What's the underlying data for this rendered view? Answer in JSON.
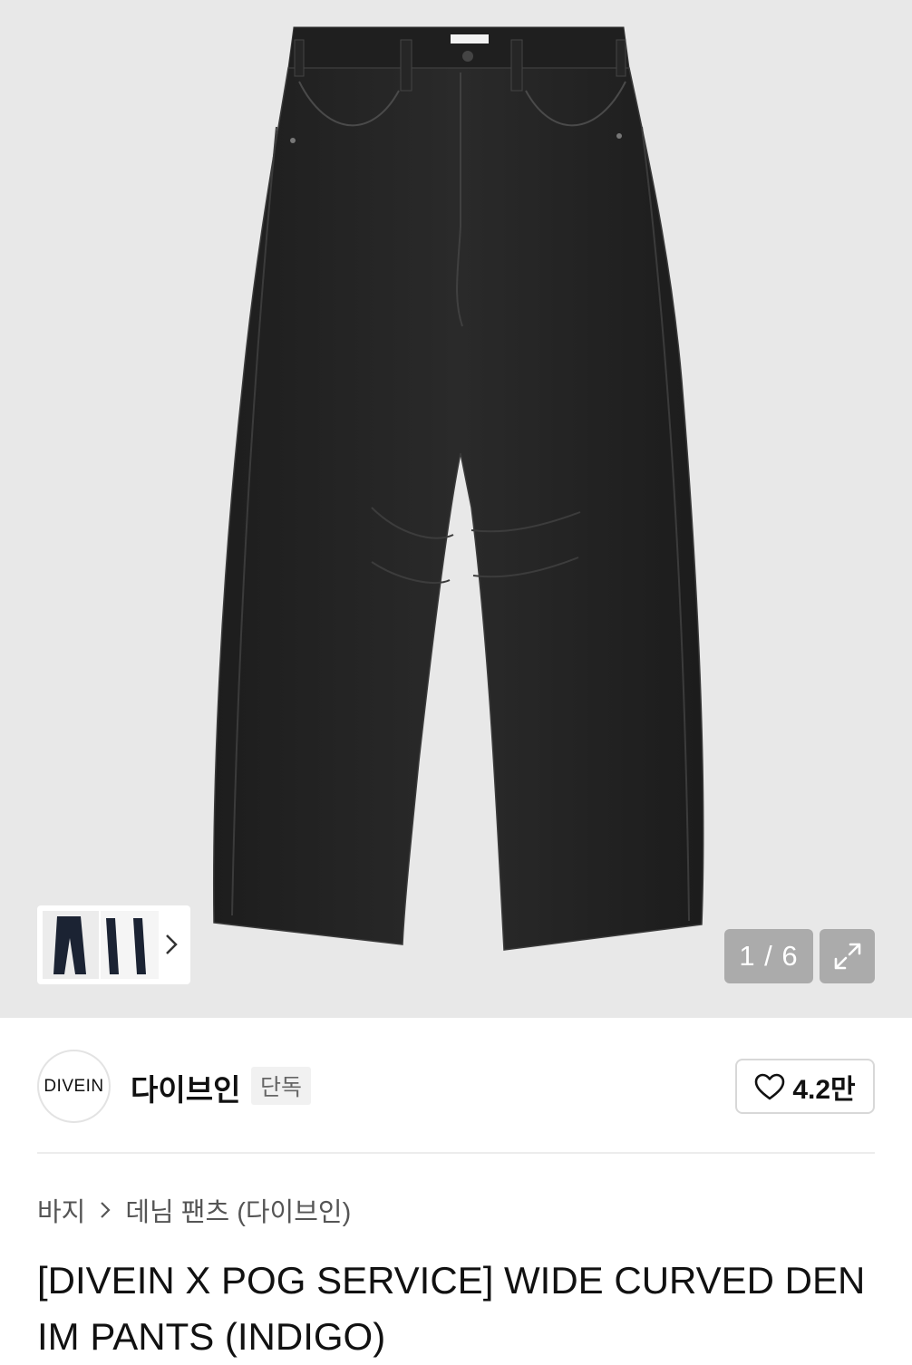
{
  "gallery": {
    "page_current": "1",
    "page_total": "6",
    "page_indicator": "1 / 6"
  },
  "brand": {
    "logo_text": "DIVEIN",
    "name": "다이브인",
    "tag": "단독",
    "like_count": "4.2만"
  },
  "breadcrumb": {
    "items": [
      "바지",
      "데님 팬츠 (다이브인)"
    ]
  },
  "product": {
    "title": "[DIVEIN X POG SERVICE] WIDE CURVED DENIM PANTS (INDIGO)"
  },
  "colors": {
    "hero_bg": "#e8e8e8",
    "denim": "#242424"
  },
  "icons": [
    "chevron-right-icon",
    "expand-icon",
    "heart-icon"
  ]
}
